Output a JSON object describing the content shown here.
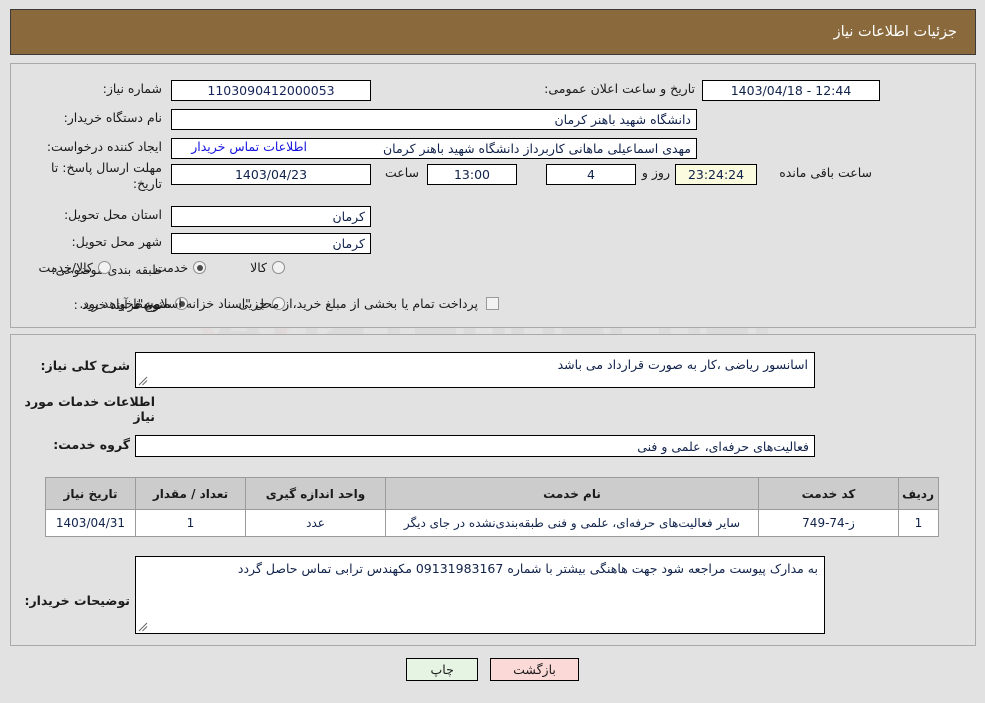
{
  "header": {
    "title": "جزئیات اطلاعات نیاز"
  },
  "form": {
    "need_number_label": "شماره نیاز:",
    "need_number_value": "1103090412000053",
    "announce_datetime_label": "تاریخ و ساعت اعلان عمومی:",
    "announce_datetime_value": "12:44 - 1403/04/18",
    "buyer_org_label": "نام دستگاه خریدار:",
    "buyer_org_value": "دانشگاه شهید باهنر کرمان",
    "requester_label": "ایجاد کننده درخواست:",
    "requester_value": "مهدی اسماعیلی ماهانی  کاربرداز دانشگاه شهید باهنر کرمان",
    "contact_link": "اطلاعات تماس خریدار",
    "deadline_label": "مهلت ارسال پاسخ: تا تاریخ:",
    "deadline_date": "1403/04/23",
    "hour_label": "ساعت",
    "deadline_time": "13:00",
    "days_remaining": "4",
    "days_word": "روز و",
    "time_remaining": "23:24:24",
    "remaining_suffix": "ساعت باقی مانده",
    "province_label": "استان محل تحویل:",
    "province_value": "کرمان",
    "city_label": "شهر محل تحویل:",
    "city_value": "کرمان",
    "category_label": "طبقه بندی موضوعی:",
    "category_options": [
      {
        "label": "کالا",
        "checked": false
      },
      {
        "label": "خدمت",
        "checked": true
      },
      {
        "label": "کالا/خدمت",
        "checked": false
      }
    ],
    "process_label": "نوع فرآیند خرید :",
    "process_options": [
      {
        "label": "جزیی",
        "checked": false
      },
      {
        "label": "متوسط",
        "checked": true
      }
    ],
    "treasury_checkbox_text": "پرداخت تمام یا بخشی از مبلغ خرید،از محل \"اسناد خزانه اسلامی\" خواهد بود.",
    "treasury_checked": false
  },
  "need_summary": {
    "label": "شرح کلی نیاز:",
    "value": "اسانسور ریاضی ،کار به صورت قرارداد می باشد"
  },
  "services_section": {
    "heading": "اطلاعات خدمات مورد نیاز",
    "group_label": "گروه خدمت:",
    "group_value": "فعالیت‌های حرفه‌ای، علمی و فنی"
  },
  "table": {
    "columns": [
      "ردیف",
      "کد خدمت",
      "نام خدمت",
      "واحد اندازه گیری",
      "تعداد / مقدار",
      "تاریخ نیاز"
    ],
    "rows": [
      {
        "row_no": "1",
        "service_code": "ز-74-749",
        "service_name": "سایر فعالیت‌های حرفه‌ای، علمی و فنی طبقه‌بندی‌نشده در جای دیگر",
        "unit": "عدد",
        "quantity": "1",
        "need_date": "1403/04/31"
      }
    ]
  },
  "buyer_notes": {
    "label": "توضیحات خریدار:",
    "value": "به مدارک پیوست مراجعه شود جهت هاهنگی بیشتر با شماره 09131983167 مکهندس ترابی تماس حاصل گردد"
  },
  "footer": {
    "print_label": "چاپ",
    "return_label": "بازگشت"
  },
  "watermark": {
    "text": "AriaTender.net"
  },
  "colors": {
    "header_bar": "#8a6a3d",
    "page_bg": "#e2e2e2",
    "link": "#1414e0",
    "print_btn": "#e6f5e3",
    "return_btn": "#fbd9d6",
    "countdown_bg": "#fbfbe0",
    "table_header": "#cccccc"
  }
}
